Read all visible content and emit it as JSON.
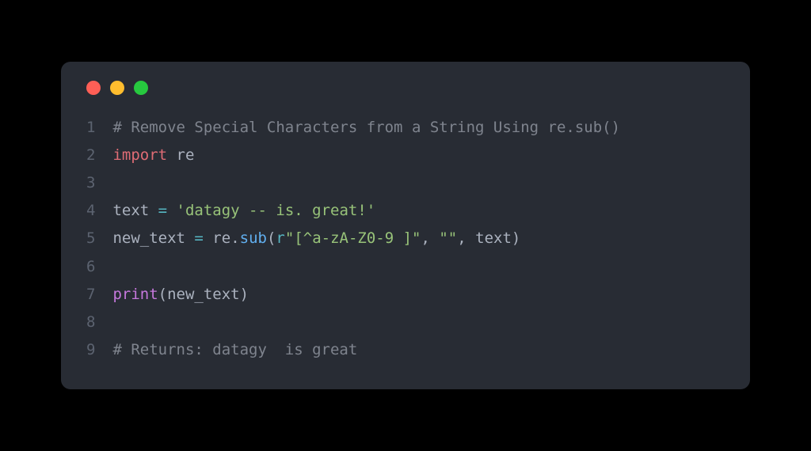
{
  "window": {
    "traffic_lights": {
      "red": "#ff5f56",
      "yellow": "#ffbd2e",
      "green": "#27c93f"
    }
  },
  "lines": {
    "l1": {
      "num": "1",
      "comment": "# Remove Special Characters from a String Using re.sub()"
    },
    "l2": {
      "num": "2",
      "kw_import": "import",
      "mod": "re"
    },
    "l3": {
      "num": "3"
    },
    "l4": {
      "num": "4",
      "var": "text",
      "eq": " = ",
      "str": "'datagy -- is. great!'"
    },
    "l5": {
      "num": "5",
      "var": "new_text",
      "eq": " = ",
      "obj": "re",
      "dot": ".",
      "fn": "sub",
      "lp": "(",
      "rprefix": "r",
      "regex": "\"[^a-zA-Z0-9 ]\"",
      "c1": ", ",
      "empty": "\"\"",
      "c2": ", ",
      "arg": "text",
      "rp": ")"
    },
    "l6": {
      "num": "6"
    },
    "l7": {
      "num": "7",
      "fn": "print",
      "lp": "(",
      "arg": "new_text",
      "rp": ")"
    },
    "l8": {
      "num": "8"
    },
    "l9": {
      "num": "9",
      "comment": "# Returns: datagy  is great"
    }
  }
}
